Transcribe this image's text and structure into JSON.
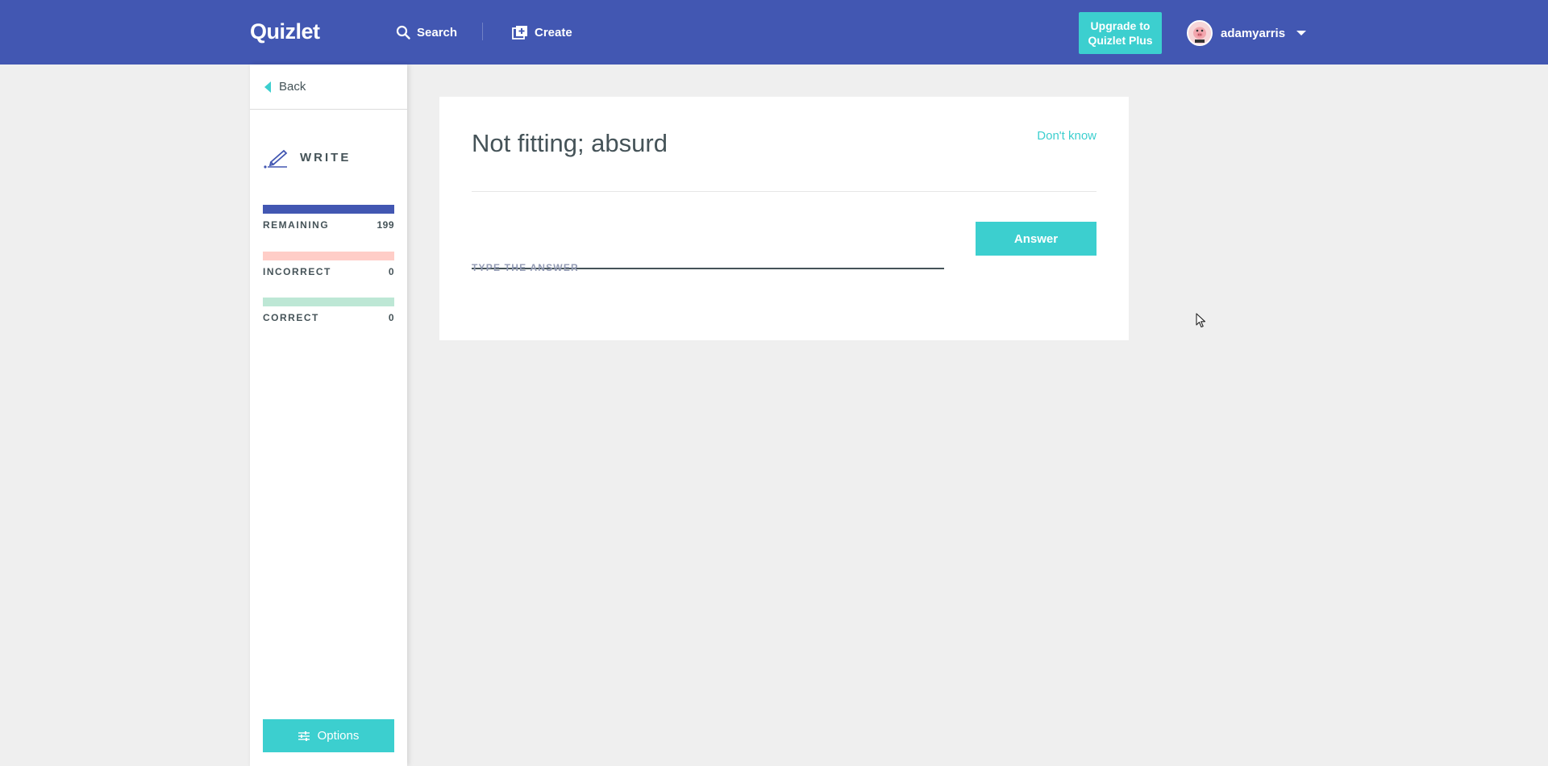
{
  "header": {
    "logo": "Quizlet",
    "search_label": "Search",
    "create_label": "Create",
    "upgrade_line1": "Upgrade to",
    "upgrade_line2": "Quizlet Plus",
    "username": "adamyarris"
  },
  "sidebar": {
    "back_label": "Back",
    "mode_label": "WRITE",
    "progress": [
      {
        "label": "REMAINING",
        "count": "199",
        "color": "#4257b2"
      },
      {
        "label": "INCORRECT",
        "count": "0",
        "color": "#ffcdc7"
      },
      {
        "label": "CORRECT",
        "count": "0",
        "color": "#bde7d5"
      }
    ],
    "options_label": "Options"
  },
  "card": {
    "prompt": "Not fitting; absurd",
    "dont_know": "Don't know",
    "input_value": "",
    "input_hint": "TYPE THE ANSWER",
    "answer_label": "Answer"
  },
  "colors": {
    "header_bg": "#4257b2",
    "accent": "#3ccfcf",
    "page_bg": "#efefef"
  }
}
